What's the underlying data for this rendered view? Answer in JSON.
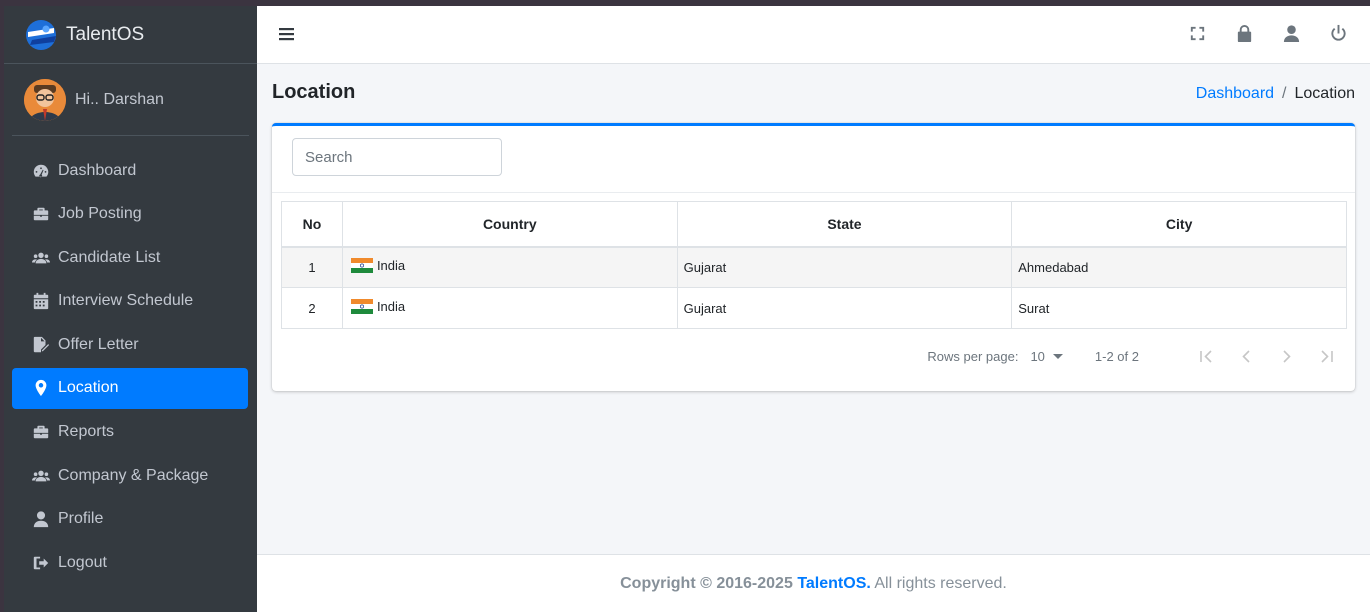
{
  "app": {
    "name": "TalentOS"
  },
  "user": {
    "greeting": "Hi.. Darshan"
  },
  "nav": [
    {
      "label": "Dashboard",
      "icon": "dashboard-icon"
    },
    {
      "label": "Job Posting",
      "icon": "briefcase-icon"
    },
    {
      "label": "Candidate List",
      "icon": "users-icon"
    },
    {
      "label": "Interview Schedule",
      "icon": "calendar-icon"
    },
    {
      "label": "Offer Letter",
      "icon": "file-signature-icon"
    },
    {
      "label": "Location",
      "icon": "map-marker-icon",
      "active": true
    },
    {
      "label": "Reports",
      "icon": "briefcase-icon"
    },
    {
      "label": "Company & Package",
      "icon": "users-icon"
    },
    {
      "label": "Profile",
      "icon": "user-icon"
    },
    {
      "label": "Logout",
      "icon": "sign-out-icon"
    }
  ],
  "topbar": {
    "icons": [
      "menu-icon",
      "fullscreen-icon",
      "lock-icon",
      "user-icon",
      "power-icon"
    ]
  },
  "page": {
    "title": "Location"
  },
  "breadcrumb": {
    "home": "Dashboard",
    "separator": "/",
    "current": "Location"
  },
  "search": {
    "placeholder": "Search",
    "value": ""
  },
  "table": {
    "columns": [
      "No",
      "Country",
      "State",
      "City"
    ],
    "rows": [
      {
        "no": "1",
        "country": "India",
        "state": "Gujarat",
        "city": "Ahmedabad"
      },
      {
        "no": "2",
        "country": "India",
        "state": "Gujarat",
        "city": "Surat"
      }
    ]
  },
  "pagination": {
    "rows_label": "Rows per page:",
    "rows_value": "10",
    "range": "1-2 of 2"
  },
  "footer": {
    "copyright": "Copyright © 2016-2025",
    "brand": "TalentOS.",
    "rights": "All rights reserved."
  },
  "colors": {
    "accent": "#007bff",
    "sidebar": "#343a40",
    "background": "#f4f6f9"
  }
}
